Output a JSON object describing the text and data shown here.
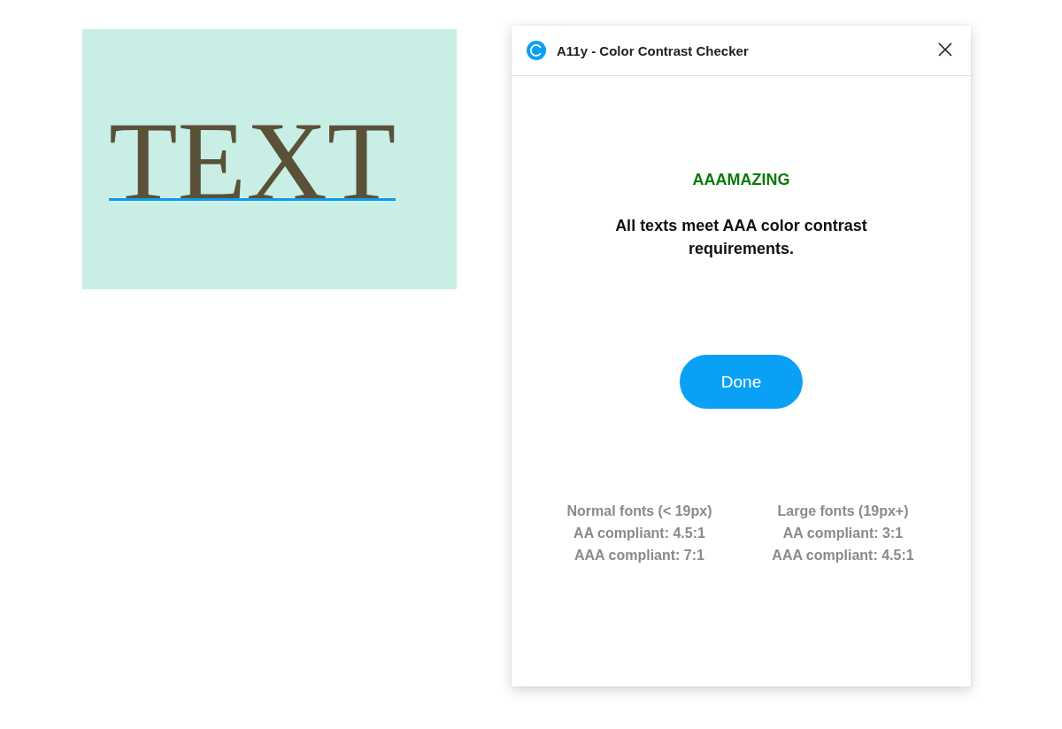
{
  "canvas": {
    "text": "TEXT",
    "selected": true
  },
  "plugin": {
    "title": "A11y - Color Contrast Checker",
    "result": {
      "kind": "pass",
      "heading": "AAAMAZING",
      "message": "All texts meet AAA color contrast requirements."
    },
    "button": "Done",
    "guidelines": [
      {
        "heading": "Normal fonts (< 19px)",
        "lines": [
          "AA compliant: 4.5:1",
          "AAA compliant: 7:1"
        ]
      },
      {
        "heading": "Large fonts (19px+)",
        "lines": [
          "AA compliant: 3:1",
          "AAA compliant: 4.5:1"
        ]
      }
    ]
  }
}
